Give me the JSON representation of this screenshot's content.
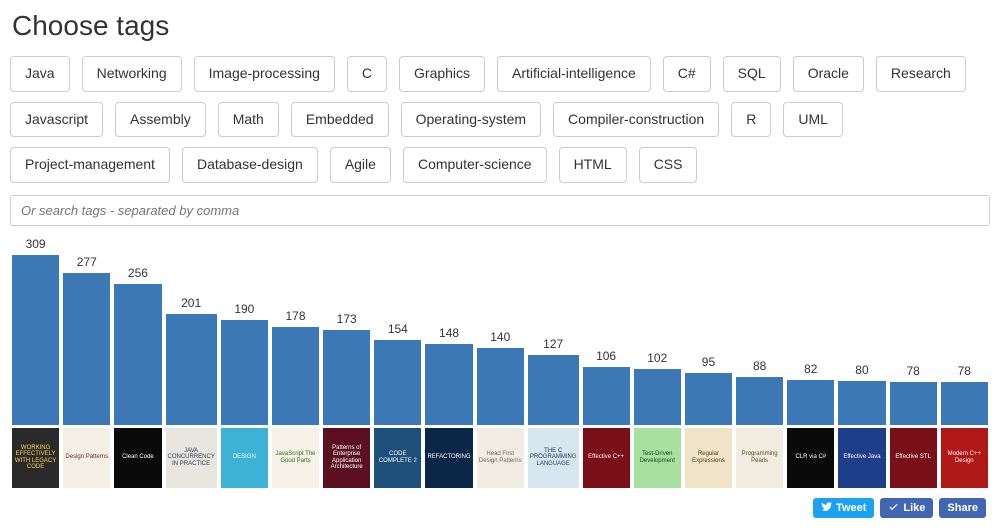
{
  "title": "Choose tags",
  "tags": [
    "Java",
    "Networking",
    "Image-processing",
    "C",
    "Graphics",
    "Artificial-intelligence",
    "C#",
    "SQL",
    "Oracle",
    "Research",
    "Javascript",
    "Assembly",
    "Math",
    "Embedded",
    "Operating-system",
    "Compiler-construction",
    "R",
    "UML",
    "Project-management",
    "Database-design",
    "Agile",
    "Computer-science",
    "HTML",
    "CSS"
  ],
  "search": {
    "placeholder": "Or search tags - separated by comma"
  },
  "chart_data": {
    "type": "bar",
    "title": "",
    "xlabel": "",
    "ylabel": "",
    "ylim": [
      0,
      309
    ],
    "categories": [
      "Working Effectively with Legacy Code",
      "Design Patterns",
      "Clean Code",
      "Java Concurrency in Practice",
      "Design Patterns (Head First)",
      "JavaScript: The Good Parts",
      "Patterns of Enterprise Application Architecture",
      "Code Complete 2",
      "Refactoring",
      "Head First Design Patterns",
      "The C Programming Language",
      "Effective C++",
      "Test-Driven Development",
      "Regular Expressions",
      "Programming Pearls",
      "CLR via C#",
      "Effective Java",
      "Effective STL",
      "Modern C++ Design"
    ],
    "values": [
      309,
      277,
      256,
      201,
      190,
      178,
      173,
      154,
      148,
      140,
      127,
      106,
      102,
      95,
      88,
      82,
      80,
      78,
      78
    ],
    "covers": [
      {
        "bg": "#2a2a2a",
        "fg": "#ffd24a",
        "title": "WORKING EFFECTIVELY WITH LEGACY CODE"
      },
      {
        "bg": "#f4f0e6",
        "fg": "#6a2b2b",
        "title": "Design Patterns"
      },
      {
        "bg": "#0a0a0a",
        "fg": "#ffffff",
        "title": "Clean Code"
      },
      {
        "bg": "#e8e6df",
        "fg": "#2b3b55",
        "title": "JAVA CONCURRENCY IN PRACTICE"
      },
      {
        "bg": "#3db2d4",
        "fg": "#ffffff",
        "title": "DESIGN"
      },
      {
        "bg": "#f6f2e8",
        "fg": "#2b6b2b",
        "title": "JavaScript The Good Parts"
      },
      {
        "bg": "#5a1020",
        "fg": "#ffffff",
        "title": "Patterns of Enterprise Application Architecture"
      },
      {
        "bg": "#1e4f7a",
        "fg": "#ffffff",
        "title": "CODE COMPLETE 2"
      },
      {
        "bg": "#0b2747",
        "fg": "#ffffff",
        "title": "REFACTORING"
      },
      {
        "bg": "#f1ede2",
        "fg": "#6b6b6b",
        "title": "Head First Design Patterns"
      },
      {
        "bg": "#d8e6ef",
        "fg": "#1d3d6b",
        "title": "THE C PROGRAMMING LANGUAGE"
      },
      {
        "bg": "#7a0f18",
        "fg": "#ffffff",
        "title": "Effective C++"
      },
      {
        "bg": "#a8e0a0",
        "fg": "#1a3d1a",
        "title": "Test-Driven Development"
      },
      {
        "bg": "#efe3c8",
        "fg": "#5b3b12",
        "title": "Regular Expressions"
      },
      {
        "bg": "#f2ede0",
        "fg": "#5b4a2a",
        "title": "Programming Pearls"
      },
      {
        "bg": "#0a0a0a",
        "fg": "#ffffff",
        "title": "CLR via C#"
      },
      {
        "bg": "#1e3e8a",
        "fg": "#ffffff",
        "title": "Effective Java"
      },
      {
        "bg": "#7a0f18",
        "fg": "#ffffff",
        "title": "Effective STL"
      },
      {
        "bg": "#b01818",
        "fg": "#ffffff",
        "title": "Modern C++ Design"
      }
    ]
  },
  "share": {
    "tweet": "Tweet",
    "like": "Like",
    "share": "Share"
  }
}
